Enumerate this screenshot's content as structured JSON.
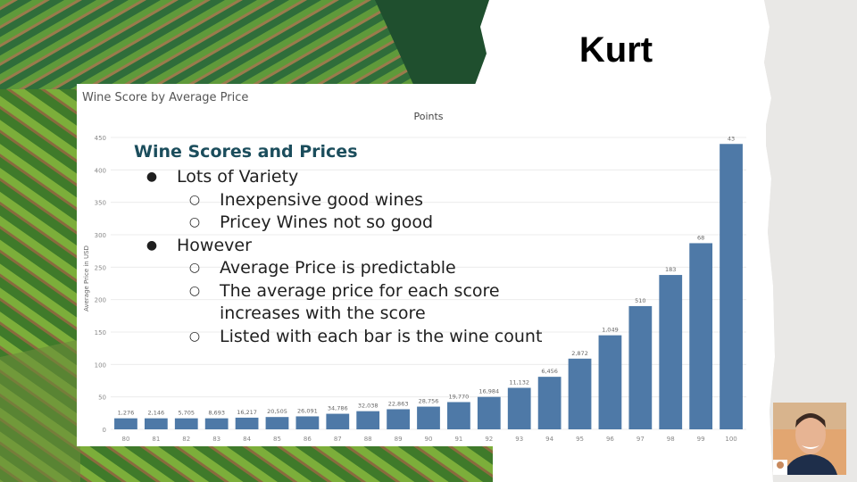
{
  "speaker": {
    "name": "Kurt"
  },
  "overlay": {
    "heading": "Wine Scores and Prices",
    "items": [
      {
        "level": 1,
        "text": "Lots of Variety"
      },
      {
        "level": 2,
        "text": "Inexpensive good wines"
      },
      {
        "level": 2,
        "text": "Pricey Wines not so good"
      },
      {
        "level": 1,
        "text": "However"
      },
      {
        "level": 2,
        "text": "Average Price is predictable"
      },
      {
        "level": 2,
        "text": "The average price for each score increases with the score"
      },
      {
        "level": 2,
        "text": "Listed with each bar is the wine count"
      }
    ]
  },
  "chart_data": {
    "type": "bar",
    "title": "Wine Score by Average Price",
    "xlabel": "Points",
    "ylabel": "Average Price in USD",
    "ylim": [
      0,
      450
    ],
    "yticks": [
      0,
      50,
      100,
      150,
      200,
      250,
      300,
      350,
      400,
      450
    ],
    "grid": true,
    "color": "#4e79a7",
    "categories": [
      "80",
      "81",
      "82",
      "83",
      "84",
      "85",
      "86",
      "87",
      "88",
      "89",
      "90",
      "91",
      "92",
      "93",
      "94",
      "95",
      "96",
      "97",
      "98",
      "99",
      "100"
    ],
    "values": [
      17,
      17,
      17,
      17,
      18,
      19,
      20,
      24,
      28,
      31,
      35,
      42,
      50,
      64,
      81,
      109,
      145,
      190,
      238,
      287,
      440
    ],
    "labels": [
      "1,276",
      "2,146",
      "5,705",
      "8,693",
      "16,217",
      "20,505",
      "26,091",
      "34,786",
      "32,038",
      "22,863",
      "28,756",
      "19,770",
      "16,984",
      "11,132",
      "6,456",
      "2,872",
      "1,049",
      "510",
      "183",
      "68",
      "43"
    ]
  }
}
